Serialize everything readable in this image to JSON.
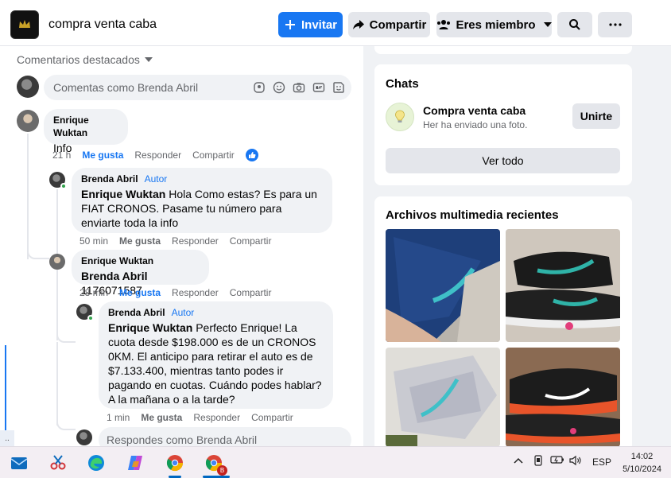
{
  "header": {
    "group_name": "compra venta caba",
    "invite_label": "Invitar",
    "share_label": "Compartir",
    "member_label": "Eres miembro"
  },
  "comments": {
    "sort_label": "Comentarios destacados",
    "composer_placeholder": "Comentas como Brenda Abril",
    "reply_placeholder": "Respondes como Brenda Abril",
    "items": [
      {
        "author": "Enrique Wuktan",
        "tag": "",
        "mention": "",
        "text": "Info",
        "time": "21 h",
        "like": "Me gusta",
        "reply": "Responder",
        "share": "Compartir"
      },
      {
        "author": "Brenda Abril",
        "tag": "Autor",
        "mention": "Enrique Wuktan",
        "text": "Hola Como estas? Es para un FIAT CRONOS. Pasame tu número para enviarte toda la info",
        "time": "50 min",
        "like": "Me gusta",
        "reply": "Responder",
        "share": "Compartir"
      },
      {
        "author": "Enrique Wuktan",
        "tag": "",
        "mention": "Brenda Abril",
        "text": "1176071587",
        "time": "28 min",
        "like": "Me gusta",
        "reply": "Responder",
        "share": "Compartir"
      },
      {
        "author": "Brenda Abril",
        "tag": "Autor",
        "mention": "Enrique Wuktan",
        "text": "Perfecto Enrique! La cuota desde $198.000 es de un CRONOS 0KM. El anticipo para retirar el auto es de $7.133.400, mientras tanto podes ir pagando en cuotas. Cuándo podes hablar? A la mañana o a la tarde?",
        "time": "1 min",
        "like": "Me gusta",
        "reply": "Responder",
        "share": "Compartir"
      }
    ]
  },
  "chats": {
    "title": "Chats",
    "name": "Compra venta caba",
    "subtitle": "Her ha enviado una foto.",
    "join_label": "Unirte",
    "see_all_label": "Ver todo"
  },
  "media": {
    "title": "Archivos multimedia recientes"
  },
  "taskbar": {
    "language": "ESP",
    "time": "14:02",
    "date": "5/10/2024",
    "chrome_badge": "B"
  },
  "colors": {
    "accent": "#1877f2",
    "online": "#31a24c"
  }
}
